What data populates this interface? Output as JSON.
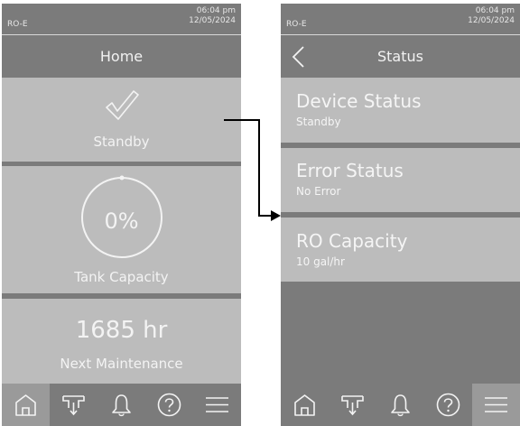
{
  "status_bar": {
    "model": "RO-E",
    "time": "06:04 pm",
    "date": "12/05/2024"
  },
  "home": {
    "title": "Home",
    "state_label": "Standby",
    "tank_percent": "0%",
    "tank_label": "Tank Capacity",
    "tank_fill": 0,
    "maintenance_value": "1685 hr",
    "maintenance_label": "Next Maintenance"
  },
  "status": {
    "title": "Status",
    "items": [
      {
        "title": "Device Status",
        "value": "Standby"
      },
      {
        "title": "Error Status",
        "value": "No Error"
      },
      {
        "title": "RO Capacity",
        "value": "10 gal/hr"
      }
    ]
  },
  "nav": {
    "items": [
      "home-icon",
      "drain-valve-icon",
      "bell-icon",
      "help-icon",
      "menu-icon"
    ],
    "active_left": "home-icon",
    "active_right": "menu-icon"
  },
  "colors": {
    "screen_bg": "#7b7b7b",
    "panel_bg": "#bcbcbc",
    "text": "#f3f3f3",
    "active_nav": "#9a9a9a"
  }
}
